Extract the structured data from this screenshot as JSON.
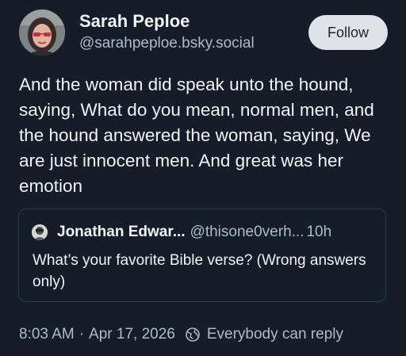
{
  "author": {
    "display_name": "Sarah Peploe",
    "handle": "@sarahpeploe.bsky.social"
  },
  "follow_label": "Follow",
  "post": {
    "text": "And the woman did speak unto the hound, saying, What do you mean, normal men, and the hound answered the woman, saying, We are just innocent men. And great was her emotion"
  },
  "quote": {
    "display_name": "Jonathan Edwar...",
    "handle": "@thisone0verh...",
    "time": "10h",
    "text": "What’s your favorite Bible verse? (Wrong answers only)"
  },
  "meta": {
    "time": "8:03 AM",
    "separator": "·",
    "date": "Apr 17, 2026",
    "reply_setting": "Everybody can reply",
    "reply_icon": "globe-icon"
  },
  "colors": {
    "background": "#151d28",
    "text": "#f1f3f5",
    "muted": "#aebbc9",
    "follow_bg": "#dfe3e8"
  }
}
